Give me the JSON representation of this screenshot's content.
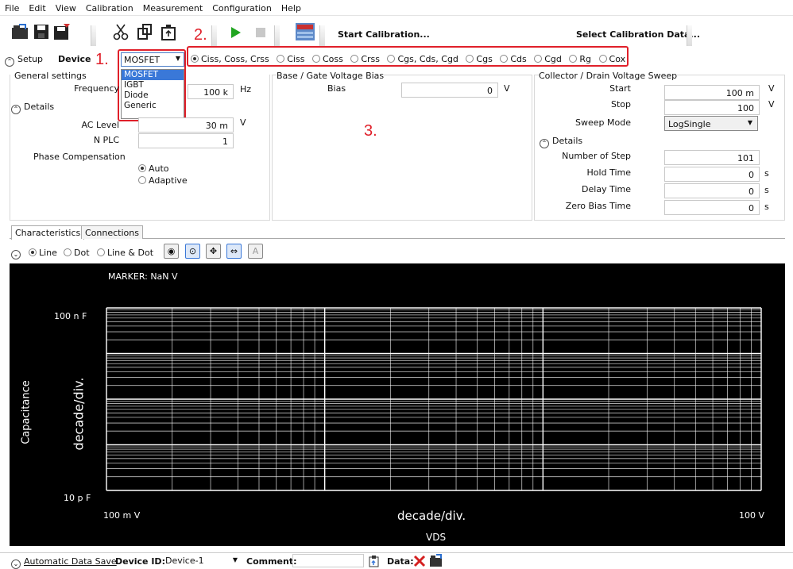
{
  "menu": [
    "File",
    "Edit",
    "View",
    "Calibration",
    "Measurement",
    "Configuration",
    "Help"
  ],
  "toolbar": {
    "start_calibration": "Start Calibration...",
    "select_calibration_data": "Select Calibration Data..."
  },
  "annotations": {
    "one": "1.",
    "two": "2.",
    "three": "3."
  },
  "setup": {
    "setup_label": "Setup",
    "device_label": "Device",
    "device_selected": "MOSFET",
    "device_options": [
      "MOSFET",
      "IGBT",
      "Diode",
      "Generic"
    ],
    "measure_options": [
      "Ciss, Coss, Crss",
      "Ciss",
      "Coss",
      "Crss",
      "Cgs, Cds, Cgd",
      "Cgs",
      "Cds",
      "Cgd",
      "Rg",
      "Cox"
    ],
    "measure_selected": "Ciss, Coss, Crss"
  },
  "general": {
    "title": "General settings",
    "frequency_label": "Frequency",
    "frequency_value": "100 k",
    "frequency_unit": "Hz",
    "details_label": "Details",
    "ac_level_label": "AC Level",
    "ac_level_value": "30 m",
    "ac_level_unit": "V",
    "nplc_label": "N PLC",
    "nplc_value": "1",
    "phase_label": "Phase Compensation",
    "phase_auto": "Auto",
    "phase_adaptive": "Adaptive"
  },
  "gate_bias": {
    "title": "Base / Gate Voltage Bias",
    "bias_label": "Bias",
    "bias_value": "0",
    "bias_unit": "V"
  },
  "sweep": {
    "title": "Collector / Drain Voltage Sweep",
    "start_label": "Start",
    "start_value": "100 m",
    "start_unit": "V",
    "stop_label": "Stop",
    "stop_value": "100",
    "stop_unit": "V",
    "mode_label": "Sweep Mode",
    "mode_value": "LogSingle",
    "details_label": "Details",
    "steps_label": "Number of Step",
    "steps_value": "101",
    "hold_label": "Hold Time",
    "hold_value": "0",
    "hold_unit": "s",
    "delay_label": "Delay Time",
    "delay_value": "0",
    "delay_unit": "s",
    "zero_label": "Zero Bias Time",
    "zero_value": "0",
    "zero_unit": "s"
  },
  "tabs": [
    "Characteristics",
    "Connections"
  ],
  "graph_options": {
    "line": "Line",
    "dot": "Dot",
    "line_dot": "Line & Dot"
  },
  "plot": {
    "marker": "MARKER: NaN V",
    "y_top": "100 n F",
    "y_bottom": "10 p F",
    "y_title": "Capacitance",
    "y_div": "decade/div.",
    "x_left": "100 m V",
    "x_right": "100  V",
    "x_div": "decade/div.",
    "x_title": "VDS"
  },
  "status": {
    "auto_save": "Automatic Data Save",
    "device_id_label": "Device ID:",
    "device_id_value": "Device-1",
    "comment_label": "Comment:",
    "data_label": "Data:"
  },
  "colors": {
    "annotation_red": "#e0202a",
    "plot_bg": "#000000",
    "grid": "#ffffff"
  }
}
